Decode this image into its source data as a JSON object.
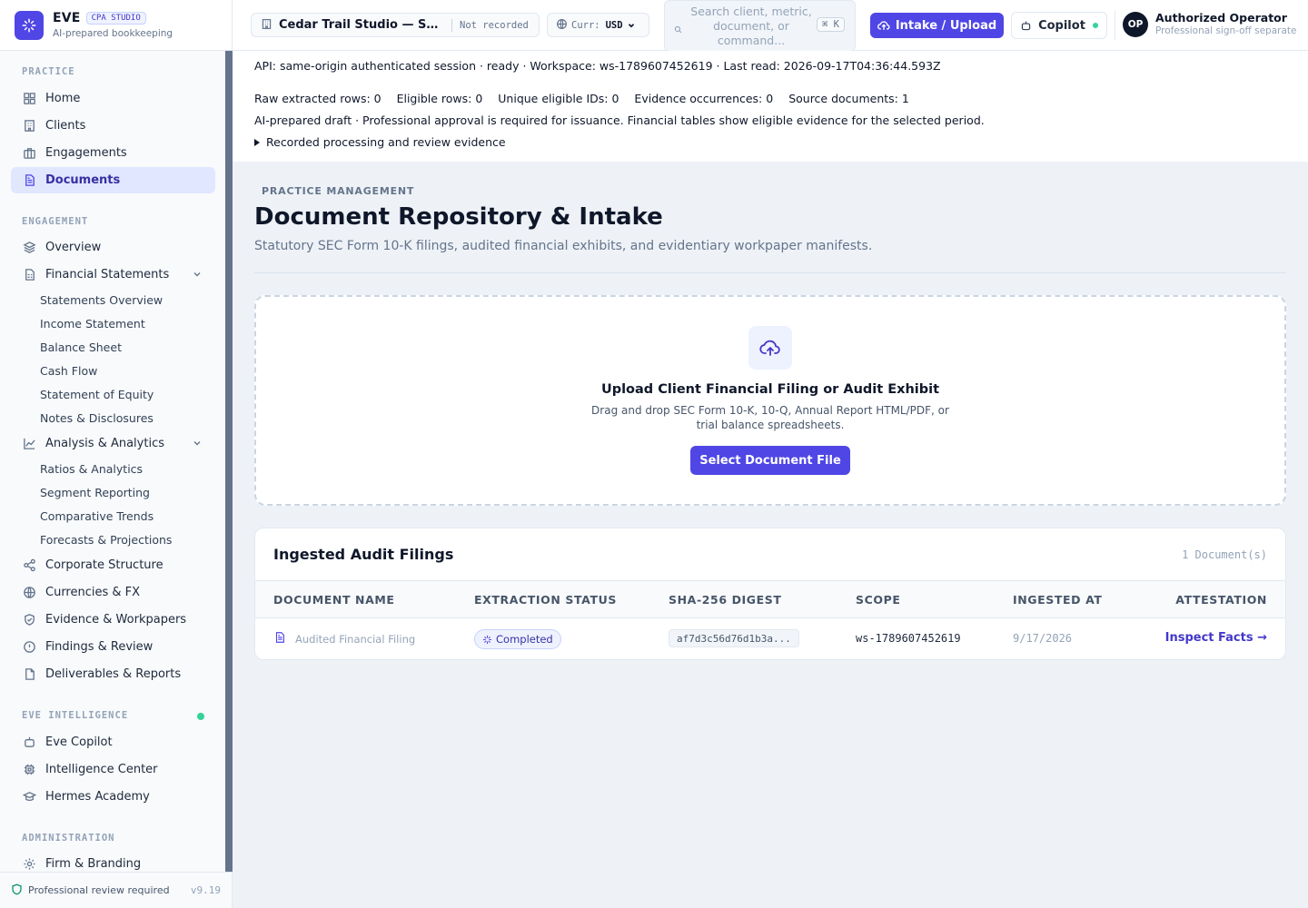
{
  "brand": {
    "name": "EVE",
    "badge": "CPA STUDIO",
    "subtitle": "AI-prepared bookkeeping"
  },
  "sidebar": {
    "sections": {
      "practice": "PRACTICE",
      "engagement": "ENGAGEMENT",
      "intelligence": "EVE INTELLIGENCE",
      "administration": "ADMINISTRATION"
    },
    "practice_items": [
      "Home",
      "Clients",
      "Engagements",
      "Documents"
    ],
    "engagement_items": {
      "overview": "Overview",
      "financial_statements": "Financial Statements",
      "fs_sub": [
        "Statements Overview",
        "Income Statement",
        "Balance Sheet",
        "Cash Flow",
        "Statement of Equity",
        "Notes & Disclosures"
      ],
      "analysis": "Analysis & Analytics",
      "analysis_sub": [
        "Ratios & Analytics",
        "Segment Reporting",
        "Comparative Trends",
        "Forecasts & Projections"
      ],
      "rest": [
        "Corporate Structure",
        "Currencies & FX",
        "Evidence & Workpapers",
        "Findings & Review",
        "Deliverables & Reports"
      ]
    },
    "intelligence_items": [
      "Eve Copilot",
      "Intelligence Center",
      "Hermes Academy"
    ],
    "admin_items": [
      "Firm & Branding"
    ],
    "footer": {
      "text": "Professional review required",
      "version": "v9.19"
    }
  },
  "topbar": {
    "workspace": "Cedar Trail Studio — Syn…",
    "workspace_status": "Not recorded",
    "currency_label": "Curr:",
    "currency_value": "USD",
    "search_placeholder": "Search client, metric, document, or command...",
    "search_kbd": "⌘ K",
    "intake_button": "Intake / Upload",
    "copilot_button": "Copilot",
    "avatar": "OP",
    "user_name": "Authorized Operator",
    "user_role": "Professional sign-off separate"
  },
  "status": {
    "api_line": "API: same-origin authenticated session · ready · Workspace: ws-1789607452619 · Last read: 2026-09-17T04:36:44.593Z",
    "counts": [
      "Raw extracted rows: 0",
      "Eligible rows: 0",
      "Unique eligible IDs: 0",
      "Evidence occurrences: 0",
      "Source documents: 1"
    ],
    "draft_line": "AI-prepared draft · Professional approval is required for issuance. Financial tables show eligible evidence for the selected period.",
    "evidence_toggle": "Recorded processing and review evidence"
  },
  "page": {
    "eyebrow": "PRACTICE MANAGEMENT",
    "title": "Document Repository & Intake",
    "subtitle": "Statutory SEC Form 10-K filings, audited financial exhibits, and evidentiary workpaper manifests."
  },
  "dropzone": {
    "title": "Upload Client Financial Filing or Audit Exhibit",
    "desc": "Drag and drop SEC Form 10-K, 10-Q, Annual Report HTML/PDF, or trial balance spreadsheets.",
    "button": "Select Document File"
  },
  "filings": {
    "title": "Ingested Audit Filings",
    "count": "1 Document(s)",
    "columns": [
      "DOCUMENT NAME",
      "EXTRACTION STATUS",
      "SHA-256 DIGEST",
      "SCOPE",
      "INGESTED AT",
      "ATTESTATION"
    ],
    "rows": [
      {
        "name": "Audited Financial Filing",
        "status": "Completed",
        "digest": "af7d3c56d76d1b3a...",
        "scope": "ws-1789607452619",
        "ingested": "9/17/2026",
        "action": "Inspect Facts →"
      }
    ]
  },
  "colors": {
    "accent": "#4f46e5",
    "active_bg": "#e0e7ff",
    "online": "#34d399"
  }
}
